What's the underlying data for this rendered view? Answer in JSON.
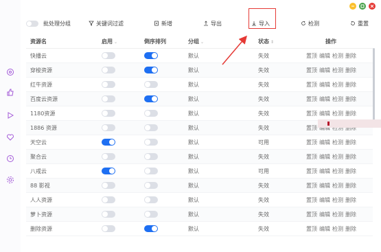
{
  "toolbar": {
    "batch_label": "批处理分组",
    "keyword_filter": "关键词过滤",
    "new": "新增",
    "export": "导出",
    "import": "导入",
    "check": "检测",
    "reset": "重置"
  },
  "table": {
    "headers": {
      "name": "资源名",
      "enable": "启用",
      "reverse": "倒序排列",
      "group": "分组",
      "status": "状态",
      "ops": "操作"
    },
    "ops": [
      "置顶",
      "编辑",
      "检测",
      "删除"
    ],
    "rows": [
      {
        "name": "快播云",
        "enable": false,
        "reverse": true,
        "group": "默认",
        "status": "失效"
      },
      {
        "name": "穿梭资源",
        "enable": false,
        "reverse": true,
        "group": "默认",
        "status": "失效"
      },
      {
        "name": "红牛资源",
        "enable": false,
        "reverse": false,
        "group": "默认",
        "status": "失效"
      },
      {
        "name": "百度云资源",
        "enable": false,
        "reverse": true,
        "group": "默认",
        "status": "失效"
      },
      {
        "name": "1180资源",
        "enable": false,
        "reverse": false,
        "group": "默认",
        "status": "失效"
      },
      {
        "name": "1886 资源",
        "enable": false,
        "reverse": false,
        "group": "默认",
        "status": "失效"
      },
      {
        "name": "天空云",
        "enable": true,
        "reverse": false,
        "group": "默认",
        "status": "可用"
      },
      {
        "name": "聚合云",
        "enable": false,
        "reverse": false,
        "group": "默认",
        "status": "失效"
      },
      {
        "name": "八戒云",
        "enable": true,
        "reverse": false,
        "group": "默认",
        "status": "可用"
      },
      {
        "name": "88 影视",
        "enable": false,
        "reverse": false,
        "group": "默认",
        "status": "失效"
      },
      {
        "name": "人人资源",
        "enable": false,
        "reverse": false,
        "group": "默认",
        "status": "失效"
      },
      {
        "name": "萝卜资源",
        "enable": false,
        "reverse": false,
        "group": "默认",
        "status": "失效"
      },
      {
        "name": "删除资源",
        "enable": false,
        "reverse": true,
        "group": "默认",
        "status": "失效"
      }
    ]
  },
  "colors": {
    "accent": "#1e6ff2",
    "highlight_red": "#e53935",
    "sidebar_icon": "#a35ad8"
  },
  "sidebar_icons": [
    "gallery-icon",
    "thumbs-up-icon",
    "play-icon",
    "heart-icon",
    "clock-icon",
    "settings-icon"
  ]
}
